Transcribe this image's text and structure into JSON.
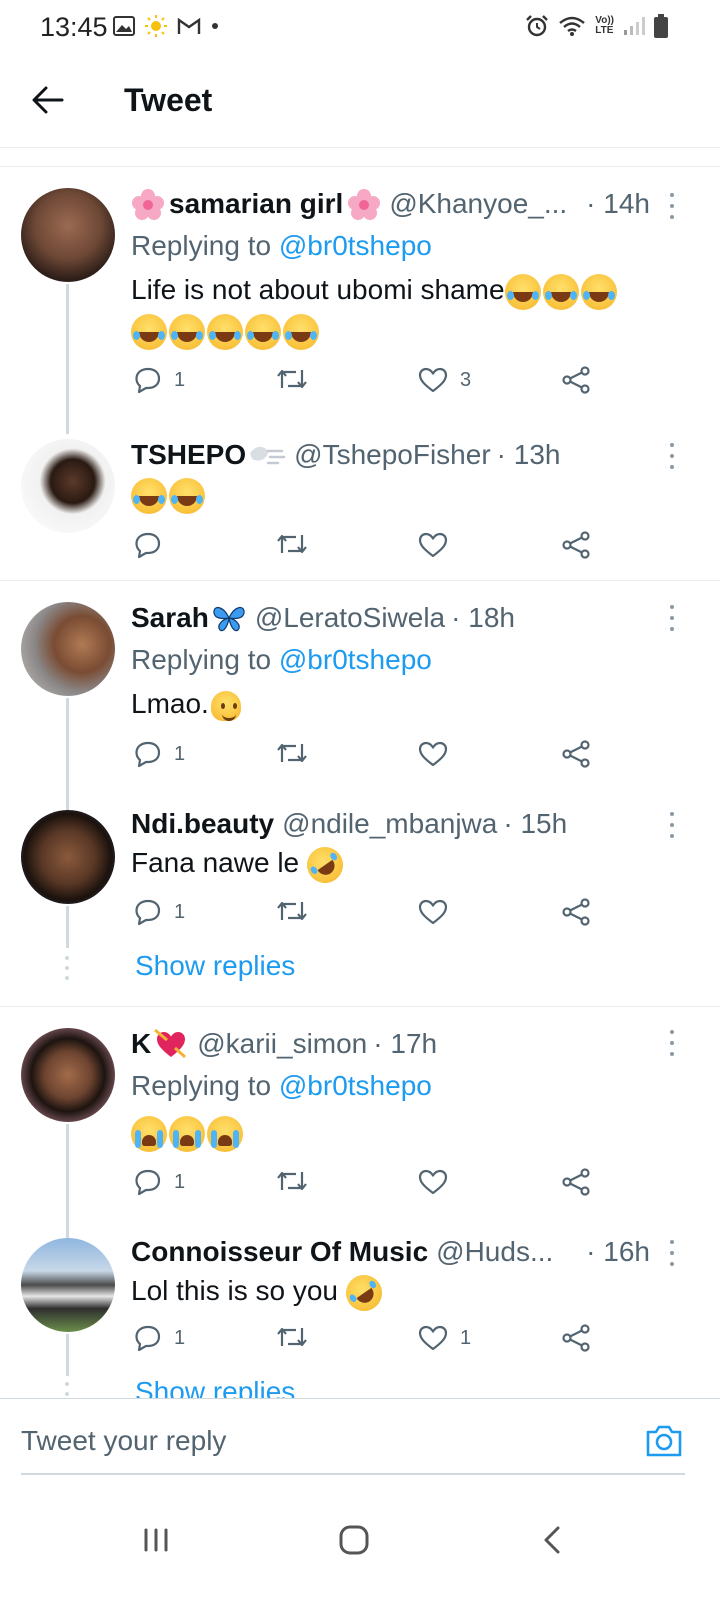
{
  "status_bar": {
    "time": "13:45",
    "left_icons": [
      "image-icon",
      "sun-icon",
      "gmail-icon",
      "dot-icon"
    ],
    "right_icons": [
      "alarm-icon",
      "wifi-icon",
      "volte-icon",
      "signal-icon",
      "battery-icon"
    ],
    "volte_label_top": "Vo))",
    "volte_label_bottom": "LTE"
  },
  "header": {
    "back_icon": "arrow-left-icon",
    "title": "Tweet"
  },
  "tweets": [
    {
      "name": "samarian girl",
      "name_prefix_emoji": "flower",
      "name_suffix_emoji": "flower",
      "handle": "@Khanyoe_...",
      "time": "· 14h",
      "replying_label": "Replying to",
      "replying_to": "@br0tshepo",
      "text_line1": "Life is not about ubomi shame",
      "text_emojis": [
        "laugh",
        "laugh",
        "laugh",
        "laugh",
        "laugh",
        "laugh",
        "laugh",
        "laugh"
      ],
      "reply_count": "1",
      "like_count": "3"
    },
    {
      "name": "TSHEPO",
      "name_suffix_emoji": "wind",
      "handle": "@TshepoFisher",
      "time": "· 13h",
      "text_emojis": [
        "laugh",
        "laugh"
      ],
      "reply_count": "",
      "like_count": ""
    },
    {
      "name": "Sarah",
      "name_suffix_emoji": "butterfly",
      "handle": "@LeratoSiwela",
      "time": "· 18h",
      "replying_label": "Replying to",
      "replying_to": "@br0tshepo",
      "text": "Lmao.",
      "text_emojis": [
        "melt"
      ],
      "reply_count": "1",
      "like_count": ""
    },
    {
      "name": "Ndi.beauty",
      "handle": "@ndile_mbanjwa",
      "time": "· 15h",
      "text": "Fana nawe le",
      "text_emojis": [
        "rofl"
      ],
      "reply_count": "1",
      "like_count": "",
      "show_replies": "Show replies"
    },
    {
      "name": "K",
      "name_suffix_emoji": "heart-arrow",
      "handle": "@karii_simon",
      "time": "· 17h",
      "replying_label": "Replying to",
      "replying_to": "@br0tshepo",
      "text_emojis": [
        "cry",
        "cry",
        "cry"
      ],
      "reply_count": "1",
      "like_count": ""
    },
    {
      "name": "Connoisseur Of Music",
      "handle": "@Huds...",
      "time": "· 16h",
      "text": "Lol this is so you",
      "text_emojis": [
        "rofl"
      ],
      "reply_count": "1",
      "like_count": "1",
      "show_replies": "Show replies"
    }
  ],
  "reply_bar": {
    "placeholder": "Tweet your reply",
    "camera_icon": "camera-icon"
  },
  "nav_bar": {
    "icons": [
      "recent-apps-icon",
      "home-icon",
      "back-icon"
    ]
  },
  "colors": {
    "accent": "#1d9bf0",
    "text_primary": "#0f1419",
    "text_secondary": "#536471",
    "divider": "#e6ecf0"
  }
}
